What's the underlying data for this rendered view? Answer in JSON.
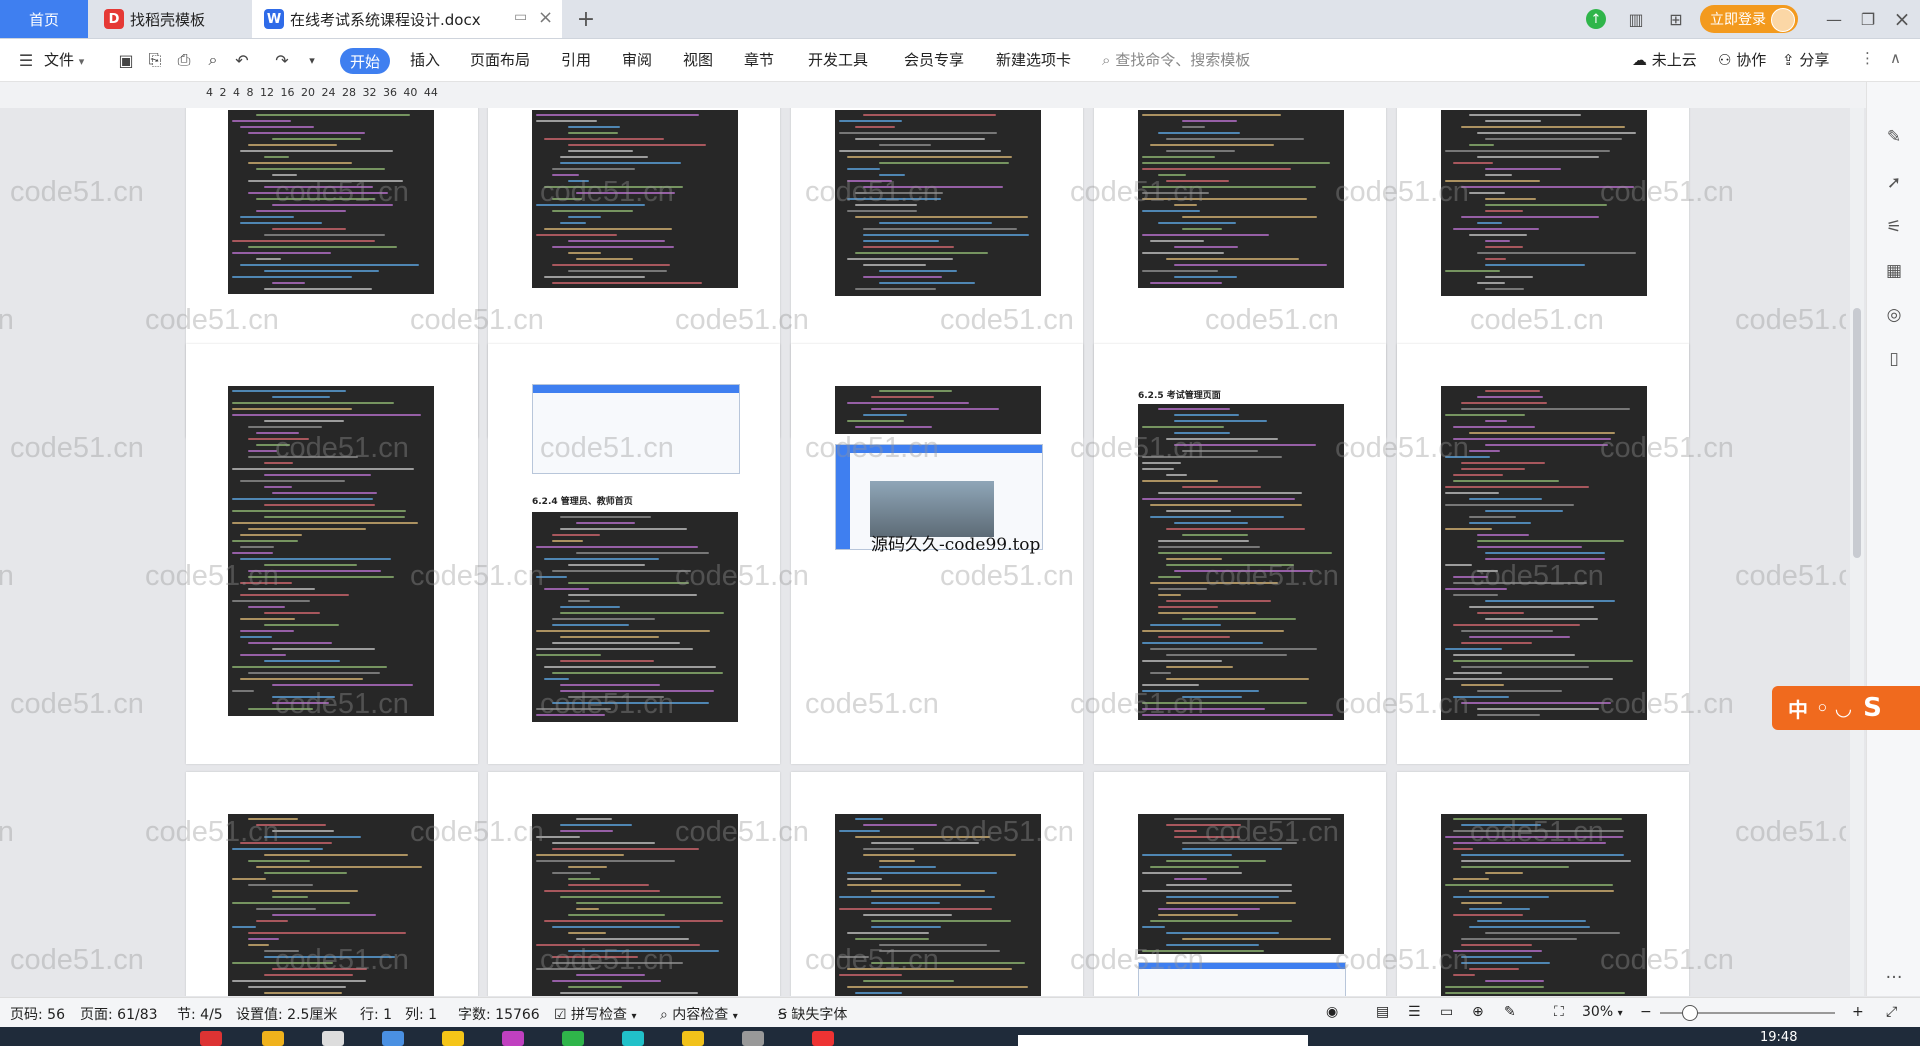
{
  "tabs": {
    "home": "首页",
    "template": "找稻壳模板",
    "doc": "在线考试系统课程设计.docx"
  },
  "titlebar": {
    "login": "立即登录"
  },
  "menubar": {
    "file": "文件",
    "items": [
      "开始",
      "插入",
      "页面布局",
      "引用",
      "审阅",
      "视图",
      "章节",
      "开发工具",
      "会员专享",
      "新建选项卡"
    ],
    "search": "查找命令、搜索模板",
    "cloud": "未上云",
    "collab": "协作",
    "share": "分享"
  },
  "ruler": {
    "ticks": "4 2 4 8 12 16 20 24 28 32 36 40 44"
  },
  "document": {
    "headings": [
      "6.2.4  管理员、教师首页",
      "6.2.5  考试管理页面"
    ],
    "caption": "源码久久-code99.top",
    "watermark": "code51.cn"
  },
  "ime": {
    "label": "中 ",
    "brand": "S"
  },
  "statusbar": {
    "page_num": "页码: 56",
    "page_of": "页面: 61/83",
    "section": "节: 4/5",
    "setting": "设置值: 2.5厘米",
    "row": "行: 1",
    "col": "列: 1",
    "wordcount": "字数: 15766",
    "spell": "拼写检查",
    "content_check": "内容检查",
    "missing_font": "缺失字体",
    "zoom": "30%"
  },
  "taskbar": {
    "time": "19:48"
  },
  "colors": {
    "accent": "#3f7ff0",
    "login": "#f39a1e",
    "code_bg": "#272727",
    "ime": "#f06a1e"
  }
}
